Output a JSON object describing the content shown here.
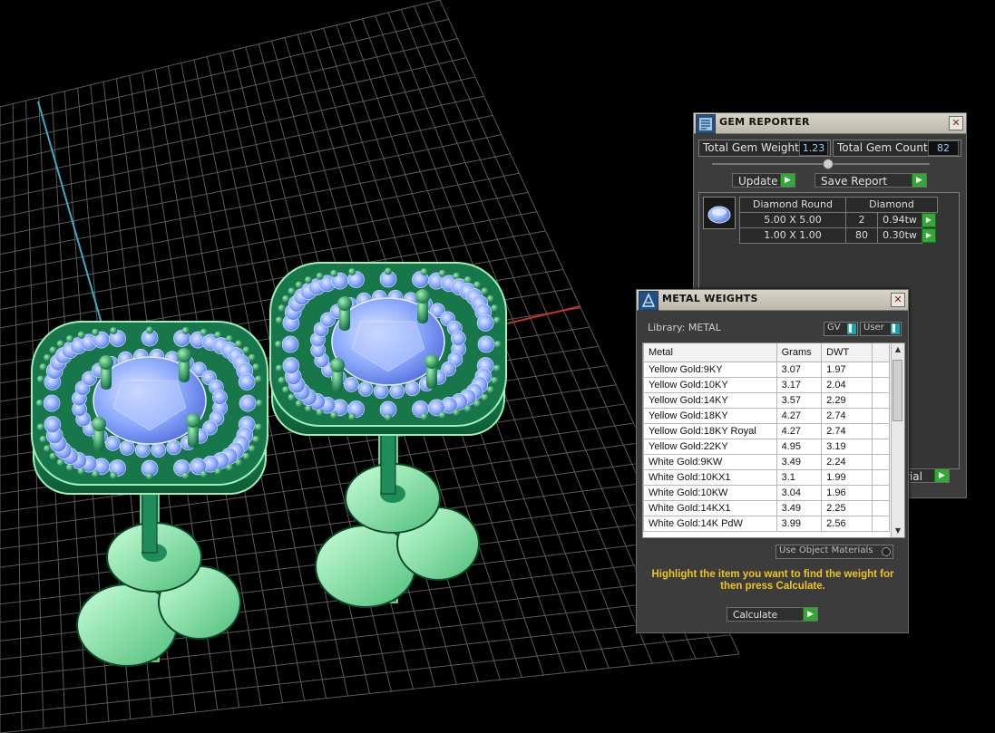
{
  "gem_reporter": {
    "title": "GEM REPORTER",
    "close_glyph": "✕",
    "total_weight_label": "Total Gem Weight",
    "total_weight_value": "1.23",
    "total_count_label": "Total Gem Count",
    "total_count_value": "82",
    "update_label": "Update",
    "save_report_label": "Save Report",
    "table": {
      "header_shape": "Diamond Round",
      "header_material": "Diamond",
      "rows": [
        {
          "size": "5.00 X 5.00",
          "count": "2",
          "weight": "0.94tw"
        },
        {
          "size": "1.00 X 1.00",
          "count": "80",
          "weight": "0.30tw"
        }
      ]
    },
    "partial_button_label": "rial"
  },
  "metal_weights": {
    "title": "METAL WEIGHTS",
    "close_glyph": "✕",
    "library_label": "Library: METAL",
    "gv_label": "GV",
    "user_label": "User",
    "columns": [
      "Metal",
      "Grams",
      "DWT"
    ],
    "rows": [
      [
        "Yellow Gold:9KY",
        "3.07",
        "1.97"
      ],
      [
        "Yellow Gold:10KY",
        "3.17",
        "2.04"
      ],
      [
        "Yellow Gold:14KY",
        "3.57",
        "2.29"
      ],
      [
        "Yellow Gold:18KY",
        "4.27",
        "2.74"
      ],
      [
        "Yellow Gold:18KY Royal",
        "4.27",
        "2.74"
      ],
      [
        "Yellow Gold:22KY",
        "4.95",
        "3.19"
      ],
      [
        "White Gold:9KW",
        "3.49",
        "2.24"
      ],
      [
        "White Gold:10KX1",
        "3.1",
        "1.99"
      ],
      [
        "White Gold:10KW",
        "3.04",
        "1.96"
      ],
      [
        "White Gold:14KX1",
        "3.49",
        "2.25"
      ],
      [
        "White Gold:14K PdW",
        "3.99",
        "2.56"
      ]
    ],
    "use_object_materials_label": "Use Object Materials",
    "hint": "Highlight the item you want to find the weight for then press Calculate.",
    "calculate_label": "Calculate"
  },
  "colors": {
    "grid_line": "#5a5a5a",
    "axis_y": "#3fa9c9",
    "axis_x": "#c0312b",
    "metal_dark": "#1f8c5c",
    "metal_light": "#9ff0b5",
    "gem": "#8aa9ff",
    "accent_green": "#34a834",
    "hint_text": "#f0c521"
  }
}
